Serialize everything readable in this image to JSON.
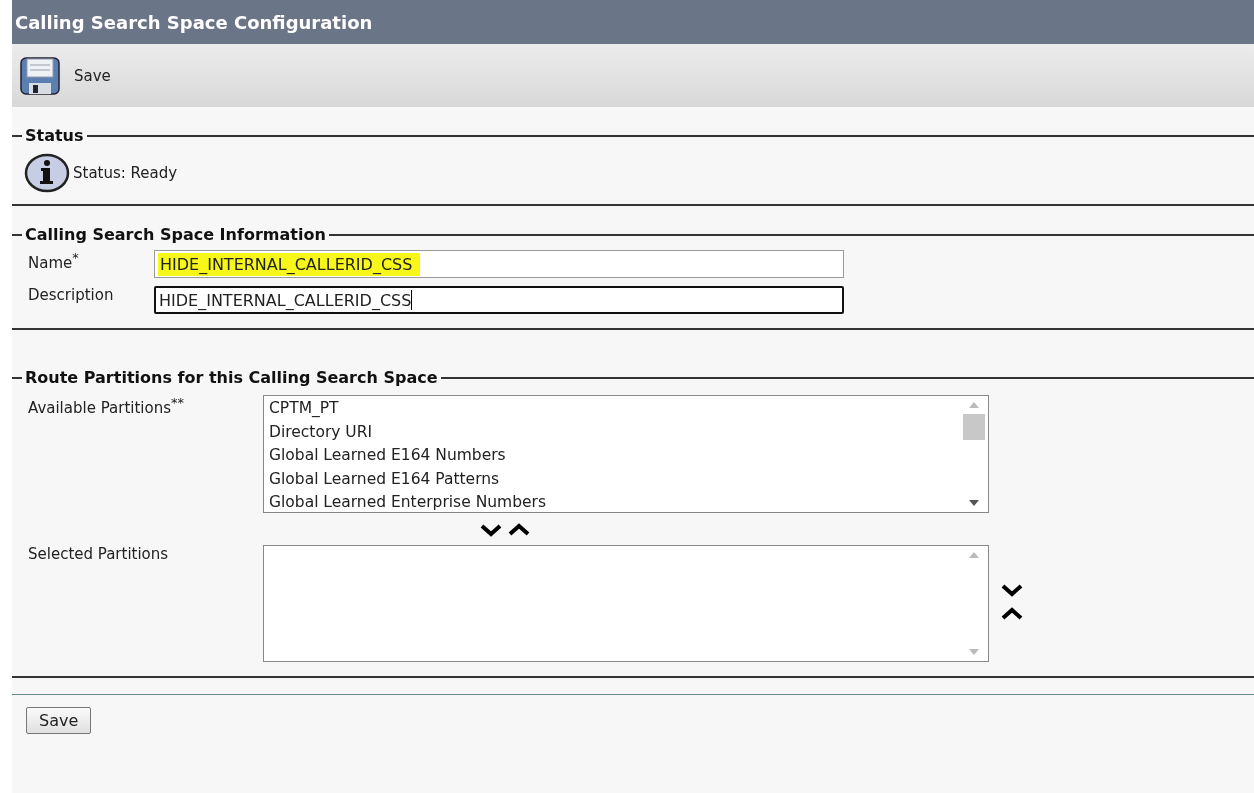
{
  "window": {
    "title": "Calling Search Space Configuration"
  },
  "toolbar": {
    "buttons": [
      {
        "label": "Save"
      }
    ]
  },
  "status": {
    "legend": "Status",
    "message": "Status: Ready"
  },
  "information": {
    "legend": "Calling Search Space Information",
    "fields": [
      {
        "label": "Name",
        "required_mark": "*",
        "value": "HIDE_INTERNAL_CALLERID_CSS",
        "highlighted": true,
        "focused": false
      },
      {
        "label": "Description",
        "value": "HIDE_INTERNAL_CALLERID_CSS",
        "highlighted": false,
        "focused": true
      }
    ]
  },
  "route_partitions": {
    "legend": "Route Partitions for this Calling Search Space",
    "available": {
      "label": "Available Partitions",
      "required_mark": "**",
      "items": [
        "CPTM_PT",
        "Directory URI",
        "Global Learned E164 Numbers",
        "Global Learned E164 Patterns",
        "Global Learned Enterprise Numbers"
      ]
    },
    "selected": {
      "label": "Selected Partitions"
    }
  },
  "footer": {
    "buttons": [
      "Save"
    ]
  }
}
